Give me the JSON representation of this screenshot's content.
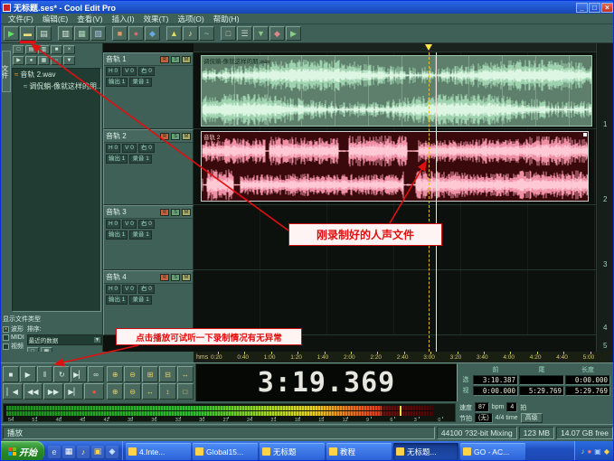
{
  "titlebar": {
    "title": "无标题.ses* - Cool Edit Pro"
  },
  "icons": {
    "min": "_",
    "max": "□",
    "close": "×",
    "dropdown_arrow": "▼",
    "file": "≈"
  },
  "menubar": {
    "items": [
      "文件(F)",
      "编辑(E)",
      "查看(V)",
      "插入(I)",
      "效果(T)",
      "选项(O)",
      "帮助(H)"
    ]
  },
  "toolbar": {
    "highlight_index": 1,
    "buttons": [
      {
        "g": "▶",
        "c": "#66dd66"
      },
      {
        "g": "▬",
        "c": "#eede77"
      },
      {
        "g": "▤",
        "c": "#d8e8dc"
      },
      {
        "g": "▥",
        "c": "#d8e8dc",
        "gap": true
      },
      {
        "g": "▦",
        "c": "#a8d8b8"
      },
      {
        "g": "▧",
        "c": "#a8c0e0"
      },
      {
        "g": "■",
        "c": "#dd9966",
        "gap": true
      },
      {
        "g": "●",
        "c": "#dd6666"
      },
      {
        "g": "◆",
        "c": "#66aadd"
      },
      {
        "g": "▲",
        "c": "#dddd66",
        "gap": true
      },
      {
        "g": "♪",
        "c": "#e8e8a0"
      },
      {
        "g": "~",
        "c": "#88ddc0"
      },
      {
        "g": "□",
        "c": "#cccccc",
        "gap": true
      },
      {
        "g": "☰",
        "c": "#c8d8d0"
      },
      {
        "g": "▼",
        "c": "#88c888"
      },
      {
        "g": "◆",
        "c": "#dd8888"
      },
      {
        "g": "▶",
        "c": "#88cc88"
      }
    ]
  },
  "left_panel": {
    "tab": "文件",
    "buttons1": [
      "□",
      "▤",
      "▥",
      "■",
      "×"
    ],
    "buttons2": [
      "▶",
      "●",
      "▦",
      "~",
      "▼"
    ],
    "files": [
      {
        "name": "音轨 2.wav"
      },
      {
        "name": "调侃躺-像就这样的朋..."
      }
    ],
    "filter": {
      "title": "显示文件类型",
      "types": [
        {
          "label": "波形",
          "checked": true
        },
        {
          "label": "MIDI",
          "checked": false
        },
        {
          "label": "视频",
          "checked": false
        }
      ],
      "sort_label": "排序:",
      "sort_value": "最近的数据",
      "extra_buttons": [
        "□",
        "▦"
      ]
    }
  },
  "tracks": [
    {
      "name": "音轨 1",
      "chips": [
        "R",
        "S",
        "M"
      ],
      "fields": [
        "H 0",
        "V 0",
        "右 0"
      ],
      "fields2": [
        "输出 1",
        "录音 1"
      ]
    },
    {
      "name": "音轨 2",
      "chips": [
        "R",
        "S",
        "M"
      ],
      "fields": [
        "H 0",
        "V 0",
        "右 0"
      ],
      "fields2": [
        "输出 1",
        "录音 1"
      ]
    },
    {
      "name": "音轨 3",
      "chips": [
        "R",
        "S",
        "M"
      ],
      "fields": [
        "H 0",
        "V 0",
        "右 0"
      ],
      "fields2": [
        "输出 1",
        "录音 1"
      ]
    },
    {
      "name": "音轨 4",
      "chips": [
        "R",
        "S",
        "M"
      ],
      "fields": [
        "H 0",
        "V 0",
        "右 0"
      ],
      "fields2": [
        "输出 1",
        "录音 1"
      ]
    }
  ],
  "clips": {
    "track1_label": "调侃躺-像就这样的朋.wav",
    "track2_label": "音轨 2"
  },
  "track_numbers": [
    "1",
    "2",
    "3",
    "4",
    "5"
  ],
  "ruler": {
    "unit": "hms",
    "ticks": [
      "0:20",
      "0:40",
      "1:00",
      "1:20",
      "1:40",
      "2:00",
      "2:20",
      "2:40",
      "3:00",
      "3:20",
      "3:40",
      "4:00",
      "4:20",
      "4:40",
      "5:00"
    ]
  },
  "transport": {
    "row1": [
      "■",
      "▶",
      "‖",
      "↻",
      "▶▏",
      "∞"
    ],
    "row2": [
      "▏◀",
      "◀◀",
      "▶▶",
      "▶▏",
      "●"
    ]
  },
  "zoom": {
    "row1": [
      "⊕",
      "⊖",
      "⊞",
      "⊟",
      "↔"
    ],
    "row2": [
      "⊕",
      "⊖",
      "↔",
      "↕",
      "□"
    ]
  },
  "time_display": "3:19.369",
  "sel_panel": {
    "headers": [
      "前",
      "尾",
      "长度"
    ],
    "rows": [
      {
        "label": "选",
        "values": [
          "3:10.387",
          "",
          "0:00.000"
        ]
      },
      {
        "label": "视",
        "values": [
          "0:00.000",
          "5:29.769",
          "5:29.769"
        ]
      }
    ]
  },
  "tempo_panel": {
    "rows": [
      [
        {
          "t": "速度"
        },
        {
          "v": "87"
        },
        {
          "t": "bpm"
        },
        {
          "v": "4"
        },
        {
          "t": "拍"
        }
      ],
      [
        {
          "t": "节拍"
        },
        {
          "v": "(无)"
        },
        {
          "t": "4/4 time"
        },
        {
          "b": "高级"
        }
      ]
    ]
  },
  "meter": {
    "scale": [
      "54",
      "51",
      "48",
      "45",
      "42",
      "39",
      "36",
      "33",
      "30",
      "27",
      "24",
      "21",
      "18",
      "15",
      "12",
      "9",
      "6",
      "3",
      "0"
    ]
  },
  "status": {
    "mode": "播放",
    "cells": [
      "44100 ?32-bit Mixing",
      "123 MB",
      "14.07 GB free"
    ]
  },
  "callouts": {
    "recorded": "刚录制好的人声文件",
    "play_hint": "点击播放可试听一下录制情况有无异常"
  },
  "taskbar": {
    "start": "开始",
    "quicklaunch": [
      {
        "name": "internet-explorer",
        "g": "e",
        "c": "#cfe4ff"
      },
      {
        "name": "show-desktop",
        "g": "▦",
        "c": "#ffffff"
      },
      {
        "name": "media-player",
        "g": "♪",
        "c": "#ffe08a"
      },
      {
        "name": "folder",
        "g": "▣",
        "c": "#ffd24a"
      },
      {
        "name": "mail",
        "g": "◆",
        "c": "#bfe0ff"
      }
    ],
    "tasks": [
      {
        "label": "4.Inte..."
      },
      {
        "label": "Global15..."
      },
      {
        "label": "无标题"
      },
      {
        "label": "教程"
      },
      {
        "label": "无标题...",
        "active": true
      },
      {
        "label": "GO - AC..."
      }
    ],
    "tray": [
      {
        "name": "volume",
        "g": "♪",
        "c": "#9fe89f"
      },
      {
        "name": "antivirus",
        "g": "●",
        "c": "#ff7a6a"
      },
      {
        "name": "network",
        "g": "▣",
        "c": "#9fc8ff"
      },
      {
        "name": "messenger",
        "g": "◆",
        "c": "#ffd24a"
      }
    ]
  }
}
